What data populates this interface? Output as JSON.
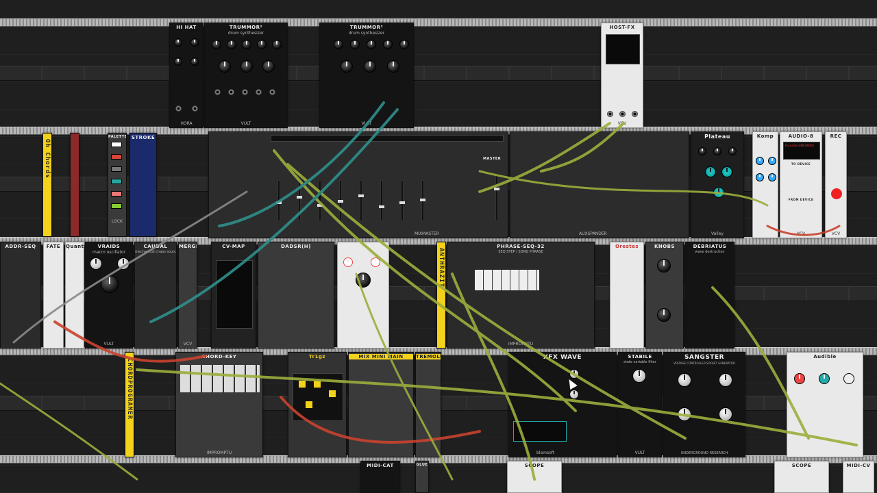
{
  "app": "VCV Rack",
  "colors": {
    "cable_olive": "#9cae3c",
    "cable_teal": "#2f8f8c",
    "cable_red": "#c8432e",
    "cable_grey": "#8a8a8a",
    "accent_yellow": "#f2d21b"
  },
  "modules": {
    "hihat": {
      "title": "HI HAT",
      "foot": "HORA"
    },
    "trummor1": {
      "title": "TRUMMOR²",
      "subtitle": "drum synthesizer",
      "foot": "VULT"
    },
    "trummor2": {
      "title": "TRUMMOR²",
      "subtitle": "drum synthesizer",
      "foot": "VULT"
    },
    "hostfx": {
      "title": "HOST-FX",
      "foot": "VCV"
    },
    "oh_chords": {
      "title": "Oh Chords"
    },
    "palette": {
      "title": "PALETTE",
      "lock": "LOCK"
    },
    "stroke": {
      "title": "STROKE"
    },
    "mixmaster": {
      "title": "MIXMASTER",
      "master": "MASTER"
    },
    "auxspander": {
      "title": "AUXSPANDER"
    },
    "plateau": {
      "title": "Plateau",
      "foot": "Valley"
    },
    "komp": {
      "title": "Komp"
    },
    "audio8": {
      "title": "AUDIO-8",
      "device": "Focusrite USB (ASIO)",
      "to_device": "TO DEVICE",
      "from_device": "FROM DEVICE",
      "foot": "VCV"
    },
    "rec": {
      "title": "REC",
      "foot": "VCV"
    },
    "adsr_seq": {
      "title": "ADDR-SEQ"
    },
    "fate": {
      "title": "FATE"
    },
    "quant": {
      "title": "Quant"
    },
    "vraids": {
      "title": "VRAIDS",
      "subtitle": "macro oscillator",
      "foot": "VULT"
    },
    "caudal": {
      "title": "CAUDAL",
      "subtitle": "mechanical chaos source"
    },
    "merge": {
      "title": "MERGE",
      "foot": "VCV"
    },
    "cvmap": {
      "title": "CV-MAP"
    },
    "dadsrh": {
      "title": "DADSR(H)"
    },
    "phraseseq": {
      "title": "PHRASE-SEQ-32",
      "subtitle": "SEQ STEP / SONG PHRASE",
      "foot": "IMPROMPTU"
    },
    "anthrazit": {
      "title": "ANTHRAZIT"
    },
    "orestes": {
      "title": "Orestes"
    },
    "knobs": {
      "title": "KNOBS"
    },
    "debriatus": {
      "title": "DEBRIATUS",
      "subtitle": "wave destruction"
    },
    "chordkey": {
      "title": "CHORD-KEY",
      "foot": "IMPROMPTU"
    },
    "chordprogramer": {
      "title": "CHORDPROGRAMER"
    },
    "trigpat": {
      "title": "Tr1gz"
    },
    "mixmaster_mini": {
      "title": "MIX MINI MAIN"
    },
    "tremolo": {
      "title": "TREMOLO"
    },
    "xfx_wave": {
      "title": "XFX WAVE",
      "foot": "blamsoft"
    },
    "stabile": {
      "title": "STABILE",
      "subtitle": "state variable filter",
      "foot": "VULT"
    },
    "sangster": {
      "title": "SANGSTER",
      "subtitle": "VOLTAGE CONTROLLED SOCKET GENERATOR",
      "foot": "UNDERGROUND RESEARCH"
    },
    "audible": {
      "title": "Audible"
    },
    "midi_cat": {
      "title": "MIDI-CAT"
    },
    "glue": {
      "title": "GLUE"
    },
    "scope1": {
      "title": "SCOPE"
    },
    "scope2": {
      "title": "SCOPE"
    },
    "midi_cv": {
      "title": "MIDI-CV"
    }
  }
}
